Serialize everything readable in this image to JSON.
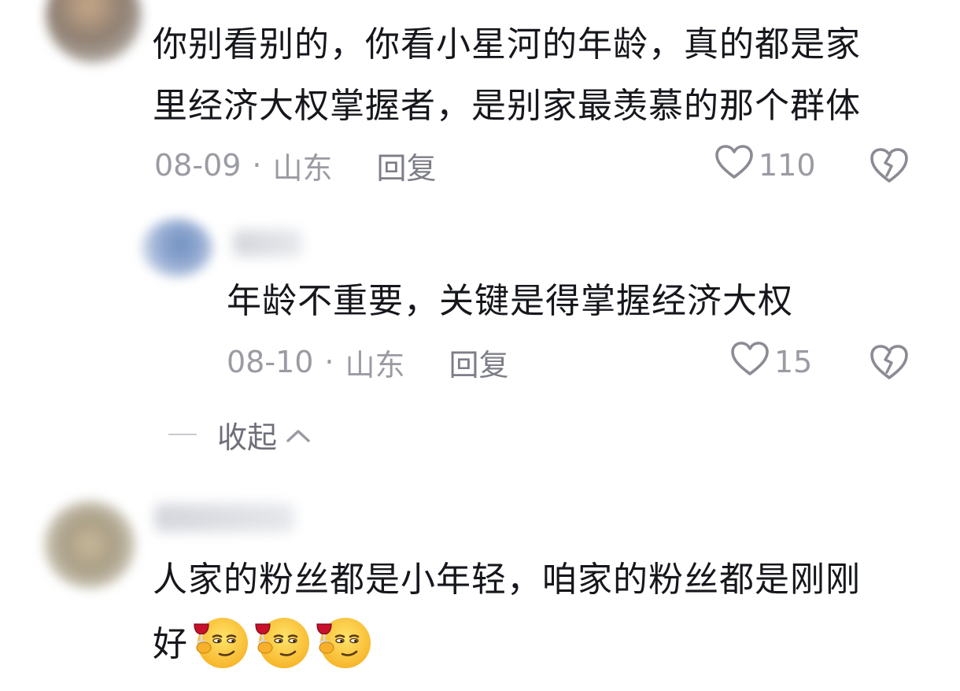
{
  "comments": [
    {
      "text_line1": "你别看别的，你看小星河的年龄，真的都是家",
      "text_line2": "里经济大权掌握者，是别家最羡慕的那个群体",
      "date": "08-09",
      "dot": "·",
      "location": "山东",
      "reply_label": "回复",
      "likes": "110",
      "avatar_icon": "avatar-blurred",
      "heart_icon": "heart-outline-icon",
      "dislike_icon": "broken-heart-icon"
    },
    {
      "text_line1": "人家的粉丝都是小年轻，咱家的粉丝都是刚刚",
      "text_line2": "好",
      "emoji_count": 3,
      "emoji_icon": "smirk-wine-emoji-icon",
      "avatar_icon": "avatar-blurred"
    }
  ],
  "reply": {
    "text": "年龄不重要，关键是得掌握经济大权",
    "date": "08-10",
    "dot": "·",
    "location": "山东",
    "reply_label": "回复",
    "likes": "15",
    "avatar_icon": "avatar-blurred",
    "heart_icon": "heart-outline-icon",
    "dislike_icon": "broken-heart-icon"
  },
  "collapse_label": "收起",
  "colors": {
    "text_primary": "#16171c",
    "text_meta": "#9a9ba3",
    "text_reply": "#7d7e87",
    "icon_gray": "#8a8b93"
  }
}
